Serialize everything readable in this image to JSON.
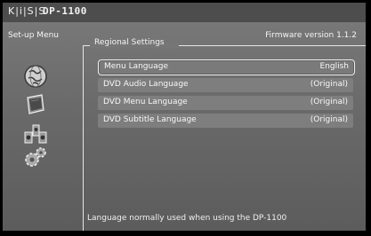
{
  "header": {
    "brand": "K|i|S|S",
    "model": "DP-1100"
  },
  "sidebar": {
    "title": "Set-up Menu",
    "icons": [
      "globe-icon",
      "display-icon",
      "speakers-icon",
      "gears-icon"
    ]
  },
  "panel": {
    "group_title": "Regional Settings",
    "firmware_version": "Firmware version 1.1.2",
    "items": [
      {
        "label": "Menu Language",
        "value": "English",
        "selected": true
      },
      {
        "label": "DVD Audio Language",
        "value": "(Original)",
        "selected": false
      },
      {
        "label": "DVD Menu Language",
        "value": "(Original)",
        "selected": false
      },
      {
        "label": "DVD Subtitle Language",
        "value": "(Original)",
        "selected": false
      }
    ],
    "help_text": "Language normally used when using the DP-1100"
  }
}
